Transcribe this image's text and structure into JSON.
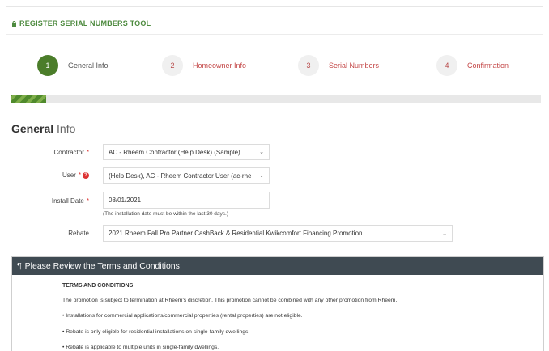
{
  "header": {
    "tool_title": "REGISTER SERIAL NUMBERS TOOL",
    "icon": "lock-icon",
    "accent_color": "#4d8a3e"
  },
  "steps": [
    {
      "number": "1",
      "label": "General Info",
      "state": "active"
    },
    {
      "number": "2",
      "label": "Homeowner Info",
      "state": "inactive"
    },
    {
      "number": "3",
      "label": "Serial Numbers",
      "state": "inactive"
    },
    {
      "number": "4",
      "label": "Confirmation",
      "state": "inactive"
    }
  ],
  "progress": {
    "percent": 6.5
  },
  "section": {
    "title_bold": "General",
    "title_light": "Info"
  },
  "form": {
    "contractor": {
      "label": "Contractor",
      "value": "AC - Rheem Contractor (Help Desk) (Sample)"
    },
    "user": {
      "label": "User",
      "value": "(Help Desk), AC - Rheem Contractor User (ac-rhe"
    },
    "install_date": {
      "label": "Install Date",
      "value": "08/01/2021",
      "hint": "(The installation date must be within the last 30 days.)"
    },
    "rebate": {
      "label": "Rebate",
      "value": "2021 Rheem Fall Pro Partner CashBack & Residential Kwikcomfort Financing Promotion"
    },
    "required_marker": "*",
    "help_marker": "?"
  },
  "terms": {
    "panel_title": "Please Review the Terms and Conditions",
    "heading": "TERMS AND CONDITIONS",
    "lines": [
      "The promotion is subject to termination at Rheem's discretion. This promotion cannot be combined with any other promotion from Rheem.",
      "• Installations for commercial applications/commercial properties (rental properties) are not eligible.",
      "• Rebate is only eligible for residential installations on single-family dwellings.",
      "• Rebate is applicable to multiple units in single-family dwellings."
    ]
  }
}
